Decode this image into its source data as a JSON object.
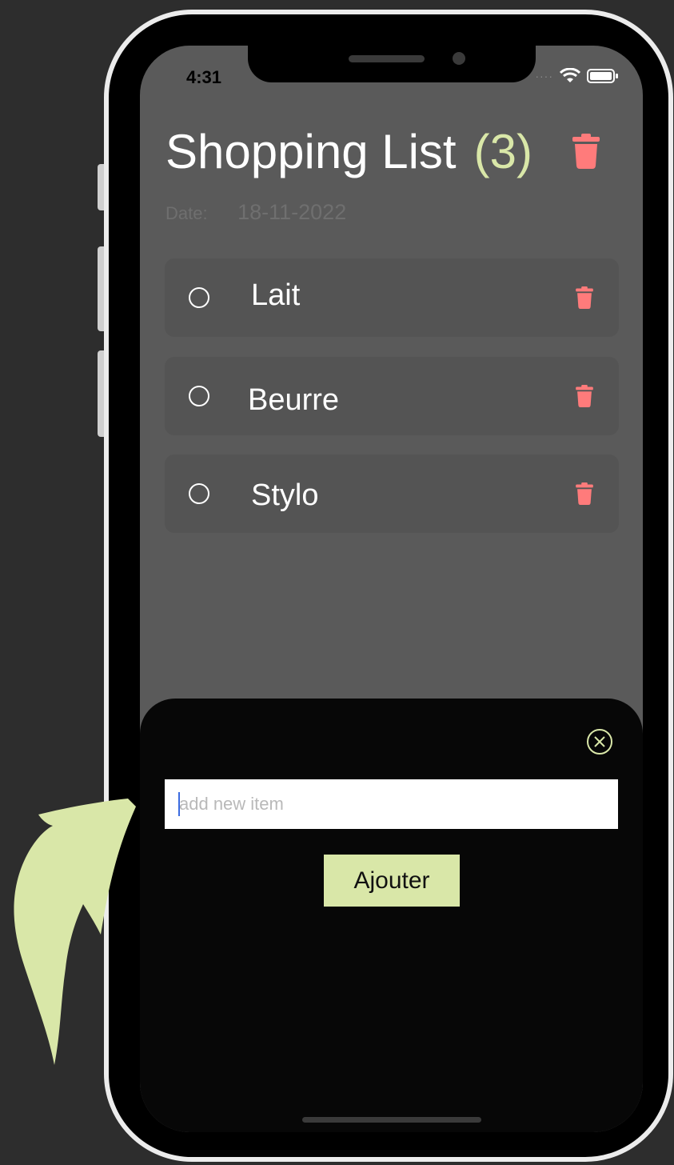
{
  "status_bar": {
    "time": "4:31"
  },
  "header": {
    "title": "Shopping List",
    "count": "(3)"
  },
  "date": {
    "label": "Date:",
    "value": "18-11-2022"
  },
  "items": [
    {
      "label": "Lait"
    },
    {
      "label": "Beurre"
    },
    {
      "label": "Stylo"
    }
  ],
  "sheet": {
    "input_placeholder": "add new item",
    "add_button_label": "Ajouter"
  },
  "colors": {
    "accent": "#d9e7a8",
    "trash": "#ff7b7b",
    "background": "#2d2d2d",
    "screen": "#5a5a5a",
    "card": "#545454",
    "sheet": "#070707"
  },
  "icons": [
    "trash-icon",
    "radio-circle-icon",
    "close-circle-icon",
    "wifi-icon",
    "battery-icon",
    "curved-arrow-icon"
  ]
}
